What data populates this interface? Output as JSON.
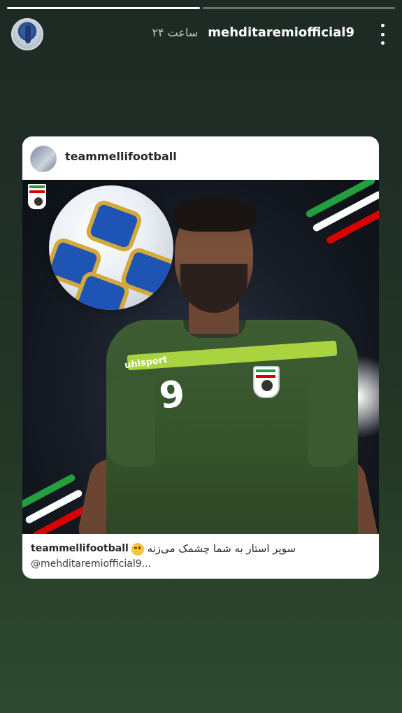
{
  "story": {
    "progress": [
      1.0,
      0.0
    ],
    "username": "mehditaremiofficial9",
    "time": "۲۴ ساعت",
    "icons": {
      "avatar": "avatar",
      "more": "more-vertical-icon"
    }
  },
  "post": {
    "username": "teammellifootball",
    "photo": {
      "shirt_number": "9",
      "brand": "uhlsport"
    },
    "caption": {
      "username": "teammellifootball",
      "text": "سوپر استار به شما چشمک می‌زنه",
      "emoji": "wink-face-icon",
      "mention": "@mehditaremiofficial9..."
    }
  },
  "colors": {
    "flag_green": "#239f40",
    "flag_red": "#da0000",
    "jersey_green": "#3e5d33",
    "jersey_band": "#a9d43f"
  }
}
